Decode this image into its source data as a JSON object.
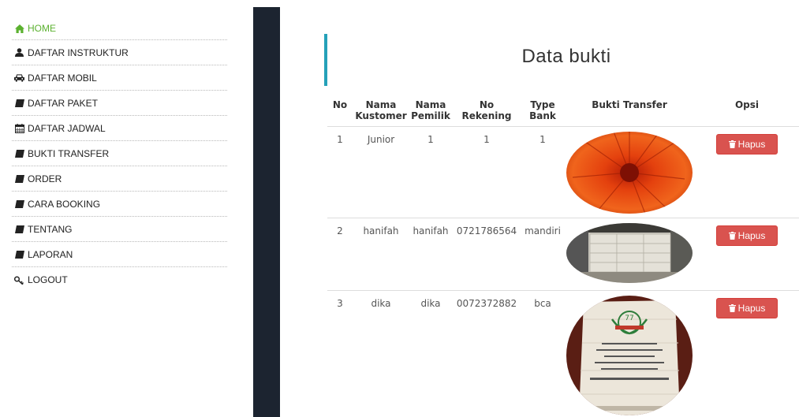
{
  "sidebar": {
    "items": [
      {
        "label": "HOME",
        "icon": "home-icon"
      },
      {
        "label": "DAFTAR INSTRUKTUR",
        "icon": "user-icon"
      },
      {
        "label": "DAFTAR MOBIL",
        "icon": "car-icon"
      },
      {
        "label": "DAFTAR PAKET",
        "icon": "book-icon"
      },
      {
        "label": "DAFTAR JADWAL",
        "icon": "calendar-icon"
      },
      {
        "label": "BUKTI TRANSFER",
        "icon": "book-icon"
      },
      {
        "label": "ORDER",
        "icon": "book-icon"
      },
      {
        "label": "CARA BOOKING",
        "icon": "book-icon"
      },
      {
        "label": "TENTANG",
        "icon": "book-icon"
      },
      {
        "label": "LAPORAN",
        "icon": "book-icon"
      },
      {
        "label": "LOGOUT",
        "icon": "key-icon"
      }
    ],
    "active_color": "#5bb12f"
  },
  "main": {
    "title": "Data bukti",
    "table": {
      "headers": {
        "no": "No",
        "nama_kustomer_1": "Nama",
        "nama_kustomer_2": "Kustomer",
        "nama_pemilik_1": "Nama",
        "nama_pemilik_2": "Pemilik",
        "no_rekening_1": "No",
        "no_rekening_2": "Rekening",
        "type_bank_1": "Type",
        "type_bank_2": "Bank",
        "bukti_transfer": "Bukti Transfer",
        "opsi": "Opsi"
      },
      "rows": [
        {
          "no": "1",
          "nama_kustomer": "Junior",
          "nama_pemilik": "1",
          "no_rekening": "1",
          "type_bank": "1",
          "image": "orange-flower-photo"
        },
        {
          "no": "2",
          "nama_kustomer": "hanifah",
          "nama_pemilik": "hanifah",
          "no_rekening": "0721786564",
          "type_bank": "mandiri",
          "image": "stacked-sacks-photo"
        },
        {
          "no": "3",
          "nama_kustomer": "dika",
          "nama_pemilik": "dika",
          "no_rekening": "0072372882",
          "type_bank": "bca",
          "image": "rice-sack-photo"
        }
      ],
      "delete_label": "Hapus"
    }
  },
  "colors": {
    "accent": "#25a1b9",
    "danger": "#d9534f",
    "dark_strip": "#1c2430"
  }
}
